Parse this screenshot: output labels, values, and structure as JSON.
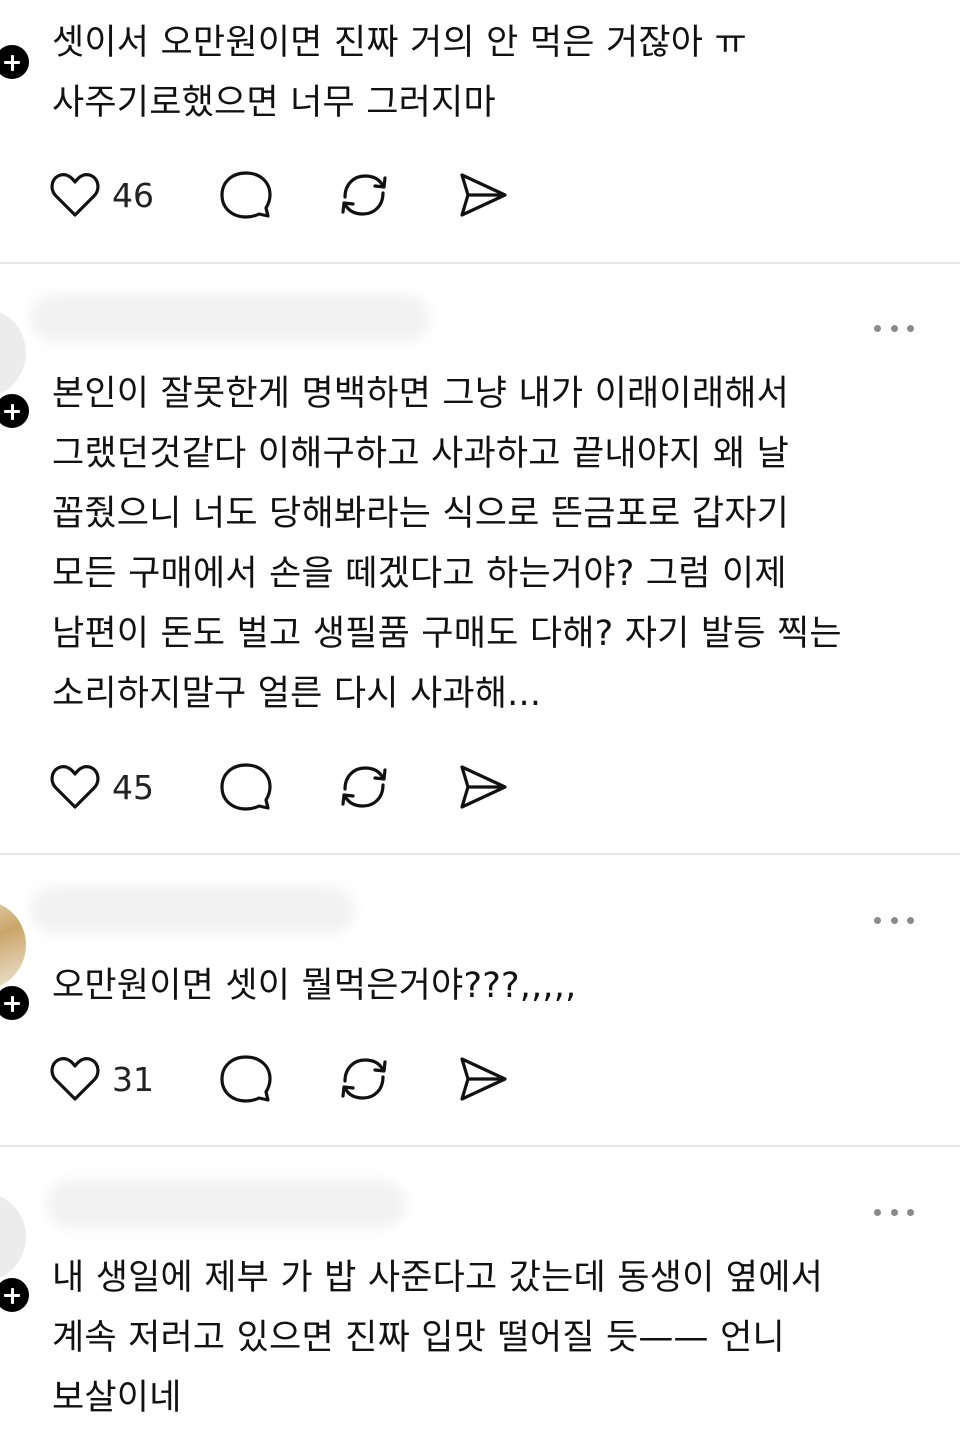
{
  "posts": [
    {
      "lines": [
        "셋이서 오만원이면 진짜 거의 안 먹은 거잖아 ㅠ",
        "사주기로했으면 너무 그러지마"
      ],
      "likes": "46"
    },
    {
      "lines": [
        "본인이 잘못한게 명백하면 그냥 내가 이래이래해서",
        "그랬던것같다 이해구하고 사과하고 끝내야지 왜 날",
        "꼽줬으니 너도 당해봐라는 식으로 뜬금포로 갑자기",
        "모든 구매에서 손을 떼겠다고 하는거야? 그럼 이제",
        "남편이 돈도 벌고 생필품 구매도 다해? 자기 발등 찍는",
        "소리하지말구 얼른 다시 사과해..."
      ],
      "likes": "45"
    },
    {
      "lines": [
        "오만원이면 셋이 뭘먹은거야???,,,,,"
      ],
      "likes": "31"
    },
    {
      "lines": [
        "내 생일에 제부 가 밥 사준다고 갔는데 동생이 옆에서",
        "계속 저러고 있으면 진짜 입맛 떨어질 듯—— 언니",
        "보살이네"
      ]
    }
  ],
  "icons": {
    "like": "heart-icon",
    "reply": "comment-bubble-icon",
    "repost": "repost-arrows-icon",
    "share": "send-icon",
    "more": "more-dots-icon",
    "follow": "plus-icon"
  }
}
